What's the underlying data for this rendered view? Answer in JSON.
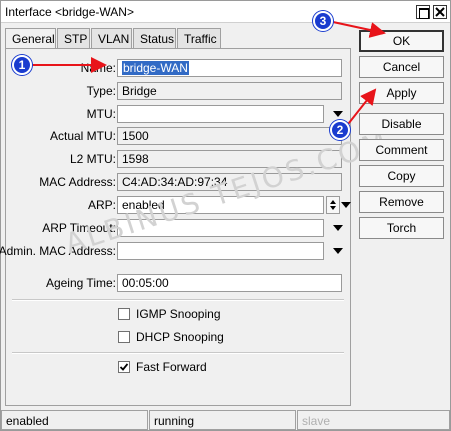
{
  "window": {
    "title": "Interface <bridge-WAN>"
  },
  "tabs": [
    {
      "label": "General"
    },
    {
      "label": "STP"
    },
    {
      "label": "VLAN"
    },
    {
      "label": "Status"
    },
    {
      "label": "Traffic"
    }
  ],
  "form": {
    "name": {
      "label": "Name:",
      "value": "bridge-WAN"
    },
    "type": {
      "label": "Type:",
      "value": "Bridge"
    },
    "mtu": {
      "label": "MTU:",
      "value": ""
    },
    "actual_mtu": {
      "label": "Actual MTU:",
      "value": "1500"
    },
    "l2_mtu": {
      "label": "L2 MTU:",
      "value": "1598"
    },
    "mac_address": {
      "label": "MAC Address:",
      "value": "C4:AD:34:AD:97:34"
    },
    "arp": {
      "label": "ARP:",
      "value": "enabled"
    },
    "arp_timeout": {
      "label": "ARP Timeout:",
      "value": ""
    },
    "admin_mac": {
      "label": "Admin. MAC Address:",
      "value": ""
    },
    "ageing_time": {
      "label": "Ageing Time:",
      "value": "00:05:00"
    },
    "igmp_snooping": {
      "label": "IGMP Snooping",
      "checked": false
    },
    "dhcp_snooping": {
      "label": "DHCP Snooping",
      "checked": false
    },
    "fast_forward": {
      "label": "Fast Forward",
      "checked": true
    }
  },
  "buttons": {
    "ok": "OK",
    "cancel": "Cancel",
    "apply": "Apply",
    "disable": "Disable",
    "comment": "Comment",
    "copy": "Copy",
    "remove": "Remove",
    "torch": "Torch"
  },
  "status": {
    "state": "enabled",
    "link": "running",
    "role": "slave"
  },
  "watermark": "ALBINUS TEJOS.COM",
  "annotations": {
    "badge1": "1",
    "badge2": "2",
    "badge3": "3",
    "arrow_color": "#e8141a",
    "badge_color": "#1a3ccf"
  }
}
